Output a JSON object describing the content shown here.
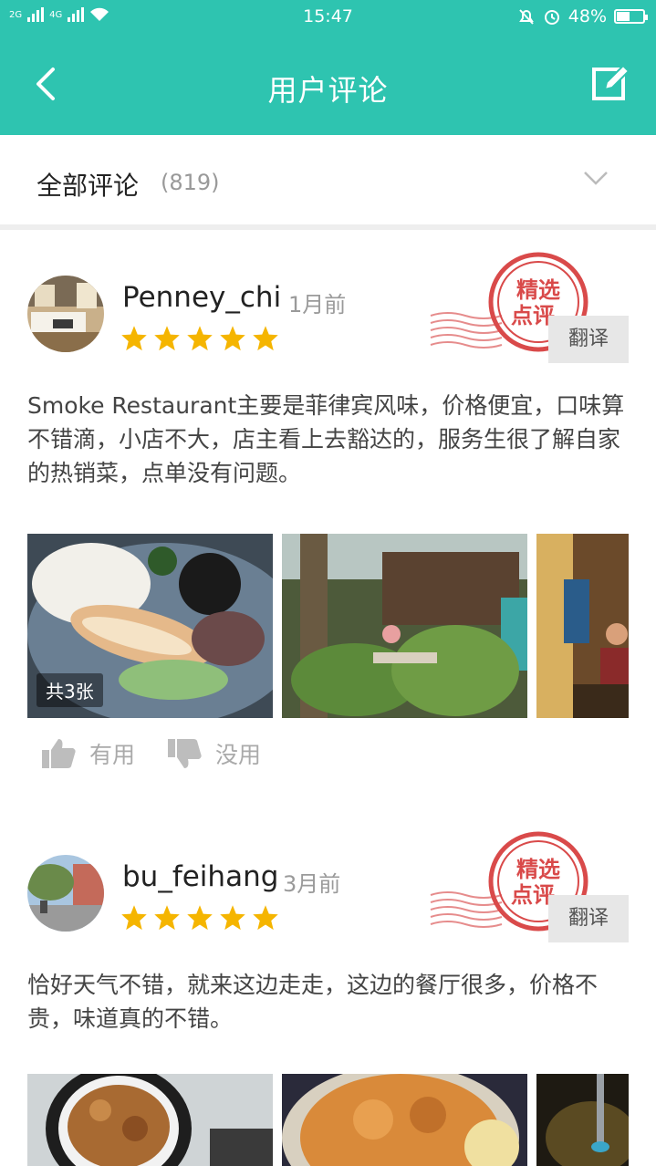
{
  "status_bar": {
    "net_left": "2G",
    "net_right": "4G",
    "time": "15:47",
    "battery": "48%",
    "battery_level": 0.48
  },
  "header": {
    "title": "用户评论",
    "back_icon": "back-arrow-icon",
    "edit_icon": "edit-icon"
  },
  "filter": {
    "label": "全部评论",
    "count": "(819)"
  },
  "reviews": [
    {
      "username": "Penney_chi",
      "time_ago": "1月前",
      "rating": 5,
      "stamp": "精选点评",
      "stamp_line1": "精选",
      "stamp_line2": "点评",
      "translate_label": "翻译",
      "text": "Smoke Restaurant主要是菲律宾风味，价格便宜，口味算不错滴，小店不大，店主看上去豁达的，服务生很了解自家的热销菜，点单没有问题。",
      "photo_count": "共3张",
      "useful_label": "有用",
      "useless_label": "没用"
    },
    {
      "username": "bu_feihang",
      "time_ago": "3月前",
      "rating": 5,
      "stamp": "精选点评",
      "stamp_line1": "精选",
      "stamp_line2": "点评",
      "translate_label": "翻译",
      "text": "恰好天气不错，就来这边走走，这边的餐厅很多，价格不贵，味道真的不错。"
    }
  ],
  "colors": {
    "accent": "#2ec4b0",
    "star": "#f5b500",
    "stamp": "#d94a4a"
  }
}
